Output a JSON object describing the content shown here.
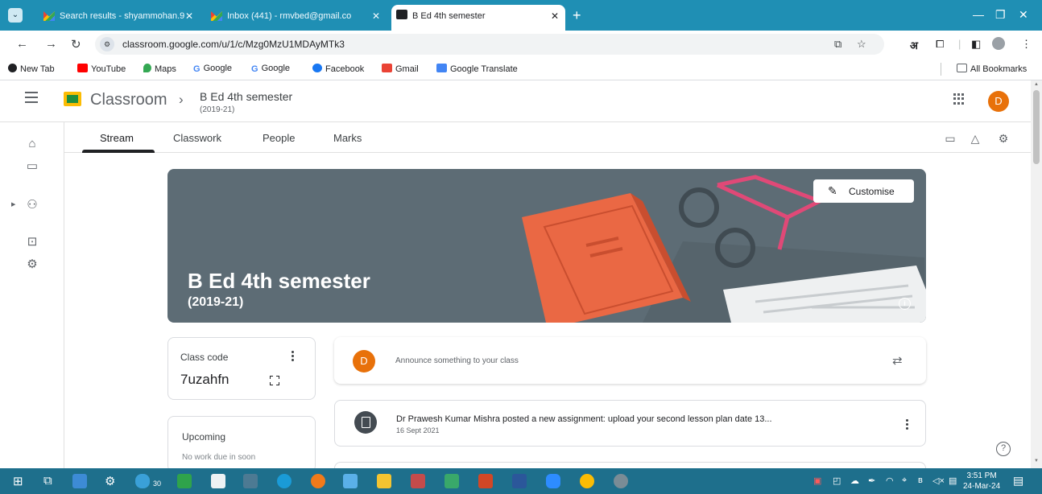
{
  "browser": {
    "tabs": [
      {
        "title": "Search results - shyammohan.9",
        "active": false
      },
      {
        "title": "Inbox (441) - rmvbed@gmail.co",
        "active": false
      },
      {
        "title": "B Ed 4th semester",
        "active": true
      }
    ],
    "tab_close": "✕",
    "new_tab": "+",
    "url": "classroom.google.com/u/1/c/Mzg0MzU1MDAyMTk3",
    "bookmarks": [
      {
        "label": "New Tab",
        "icon": "new-tab-icon",
        "color": "#202124"
      },
      {
        "label": "YouTube",
        "icon": "youtube-icon",
        "color": "#ff0000"
      },
      {
        "label": "Maps",
        "icon": "maps-icon",
        "color": "#34a853"
      },
      {
        "label": "Google",
        "icon": "google-icon",
        "color": "#4285f4"
      },
      {
        "label": "Google",
        "icon": "google-icon",
        "color": "#4285f4"
      },
      {
        "label": "Facebook",
        "icon": "facebook-icon",
        "color": "#1877f2"
      },
      {
        "label": "Gmail",
        "icon": "gmail-icon",
        "color": "#ea4335"
      },
      {
        "label": "Google Translate",
        "icon": "translate-icon",
        "color": "#4285f4"
      }
    ],
    "all_bookmarks": "All Bookmarks"
  },
  "header": {
    "app_name": "Classroom",
    "course_title": "B Ed 4th semester",
    "course_subtitle": "(2019-21)",
    "avatar_letter": "D"
  },
  "tabs": [
    "Stream",
    "Classwork",
    "People",
    "Marks"
  ],
  "banner": {
    "title": "B Ed 4th semester",
    "subtitle": "(2019-21)",
    "customise_label": "Customise",
    "bg_color": "#5d6c75"
  },
  "class_code": {
    "label": "Class code",
    "value": "7uzahfn"
  },
  "upcoming": {
    "title": "Upcoming",
    "subtitle": "No work due in soon"
  },
  "announce": {
    "avatar_letter": "D",
    "placeholder": "Announce something to your class"
  },
  "posts": [
    {
      "title": "Dr Prawesh Kumar Mishra posted a new assignment: upload your second lesson plan date 13...",
      "date": "16 Sept 2021"
    }
  ],
  "taskbar": {
    "badge": "30",
    "time": "3:51 PM",
    "date": "24-Mar-24"
  },
  "colors": {
    "accent": "#e8710a",
    "taskbar": "#1e6f8c",
    "tabstrip": "#1f8fb4"
  }
}
